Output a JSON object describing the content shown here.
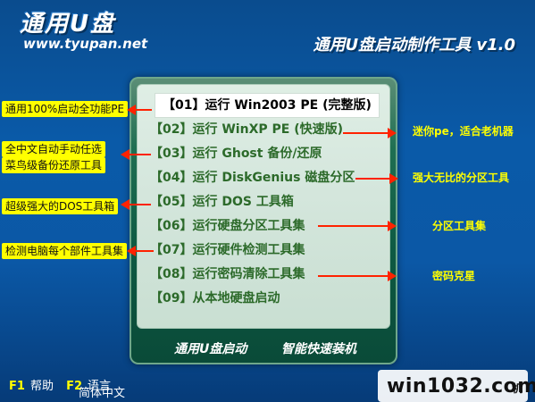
{
  "header": {
    "logo_text": "通用U盘",
    "logo_url": "www.tyupan.net",
    "app_title": "通用U盘启动制作工具 v1.0"
  },
  "menu": {
    "items": [
      {
        "label": "【01】运行 Win2003 PE (完整版)",
        "selected": true
      },
      {
        "label": "【02】运行 WinXP PE (快速版)",
        "selected": false
      },
      {
        "label": "【03】运行 Ghost 备份/还原",
        "selected": false
      },
      {
        "label": "【04】运行 DiskGenius 磁盘分区",
        "selected": false
      },
      {
        "label": "【05】运行 DOS 工具箱",
        "selected": false
      },
      {
        "label": "【06】运行硬盘分区工具集",
        "selected": false
      },
      {
        "label": "【07】运行硬件检测工具集",
        "selected": false
      },
      {
        "label": "【08】运行密码清除工具集",
        "selected": false
      },
      {
        "label": "【09】从本地硬盘启动",
        "selected": false
      }
    ]
  },
  "panel_footer": {
    "left": "通用U盘启动",
    "right": "智能快速装机"
  },
  "annotations": {
    "a1": "通用100%启动全功能PE",
    "a2_line1": "全中文自动手动任选",
    "a2_line2": "菜鸟级备份还原工具",
    "a3": "超级强大的DOS工具箱",
    "a4": "检测电脑每个部件工具集",
    "r1": "迷你pe，适合老机器",
    "r2": "强大无比的分区工具",
    "r3": "分区工具集",
    "r4": "密码克星"
  },
  "bottom_bar": {
    "f1_key": "F1",
    "f1_label": "帮助",
    "f2_key": "F2",
    "f2_label": "语言",
    "language": "简体中文"
  },
  "watermark": {
    "text": "win1032.com",
    "suffix": "机"
  },
  "colors": {
    "background": "#0a5aa8",
    "panel": "#0e5a43",
    "menu_bg": "#d4e6dc",
    "menu_text": "#2c6a2a",
    "annotation_bg": "#ffff00",
    "arrow": "#ff2200"
  }
}
